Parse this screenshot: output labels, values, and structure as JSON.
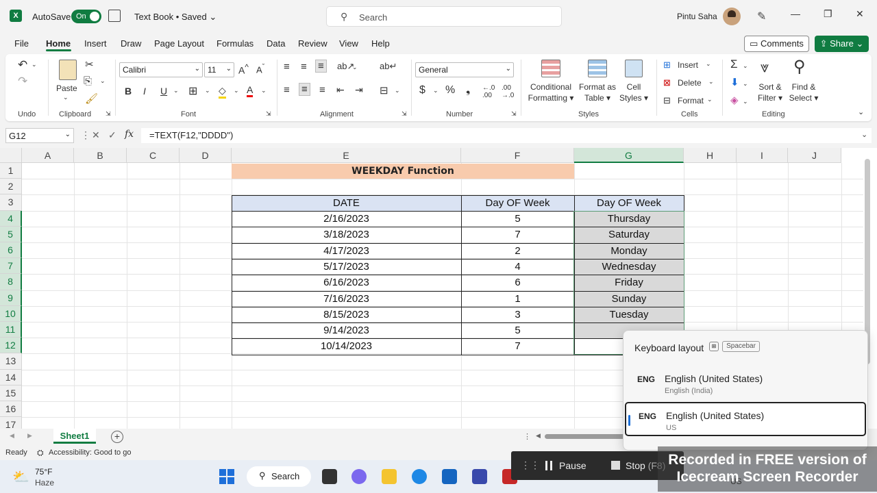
{
  "app": {
    "logo_letter": "X",
    "autosave_label": "AutoSave",
    "autosave_state": "On",
    "doc_title": "Text Book • Saved",
    "search_placeholder": "Search",
    "user_name": "Pintu Saha"
  },
  "menu": {
    "items": [
      "File",
      "Home",
      "Insert",
      "Draw",
      "Page Layout",
      "Formulas",
      "Data",
      "Review",
      "View",
      "Help"
    ],
    "active": "Home",
    "comments_label": "Comments",
    "share_label": "Share"
  },
  "ribbon": {
    "groups": [
      "Undo",
      "Clipboard",
      "Font",
      "Alignment",
      "Number",
      "Styles",
      "Cells",
      "Editing"
    ],
    "paste_label": "Paste",
    "font_name": "Calibri",
    "font_size": "11",
    "number_format": "General",
    "conditional_formatting": [
      "Conditional",
      "Formatting ▾"
    ],
    "format_as_table": [
      "Format as",
      "Table ▾"
    ],
    "cell_styles": [
      "Cell",
      "Styles ▾"
    ],
    "cells_buttons": [
      "Insert",
      "Delete",
      "Format"
    ],
    "sort_filter": [
      "Sort &",
      "Filter ▾"
    ],
    "find_select": [
      "Find &",
      "Select ▾"
    ]
  },
  "formula_bar": {
    "name_box": "G12",
    "fx": "fx",
    "formula": "=TEXT(F12,\"DDDD\")"
  },
  "sheet": {
    "columns": [
      "A",
      "B",
      "C",
      "D",
      "E",
      "F",
      "G",
      "H",
      "I",
      "J"
    ],
    "rows": [
      "1",
      "2",
      "3",
      "4",
      "5",
      "6",
      "7",
      "8",
      "9",
      "10",
      "11",
      "12",
      "13",
      "14",
      "15",
      "16",
      "17"
    ],
    "title": "WEEKDAY Function",
    "headers": [
      "DATE",
      "Day OF Week",
      "Day OF Week"
    ],
    "table": [
      {
        "date": "2/16/2023",
        "num": "5",
        "day": "Thursday"
      },
      {
        "date": "3/18/2023",
        "num": "7",
        "day": "Saturday"
      },
      {
        "date": "4/17/2023",
        "num": "2",
        "day": "Monday"
      },
      {
        "date": "5/17/2023",
        "num": "4",
        "day": "Wednesday"
      },
      {
        "date": "6/16/2023",
        "num": "6",
        "day": "Friday"
      },
      {
        "date": "7/16/2023",
        "num": "1",
        "day": "Sunday"
      },
      {
        "date": "8/15/2023",
        "num": "3",
        "day": "Tuesday"
      },
      {
        "date": "9/14/2023",
        "num": "5",
        "day": ""
      },
      {
        "date": "10/14/2023",
        "num": "7",
        "day": ""
      }
    ],
    "tab_name": "Sheet1"
  },
  "status": {
    "ready": "Ready",
    "accessibility": "Accessibility: Good to go"
  },
  "taskbar": {
    "temperature": "75°F",
    "weather": "Haze",
    "search_label": "Search",
    "lang": "US"
  },
  "keyboard_popup": {
    "title": "Keyboard layout",
    "shortcut": "Spacebar",
    "items": [
      {
        "code": "ENG",
        "name": "English (United States)",
        "sub": "English (India)"
      },
      {
        "code": "ENG",
        "name": "English (United States)",
        "sub": "US"
      }
    ]
  },
  "recorder": {
    "pause_label": "Pause",
    "stop_label": "Stop",
    "stop_key": "(F8)",
    "watermark_line1": "Recorded in FREE version of",
    "watermark_line2": "Icecream Screen Recorder"
  },
  "colors": {
    "excel_green": "#107c41",
    "title_fill": "#f8cbad",
    "header_fill": "#dae3f3",
    "result_fill": "#d9d9d9"
  }
}
